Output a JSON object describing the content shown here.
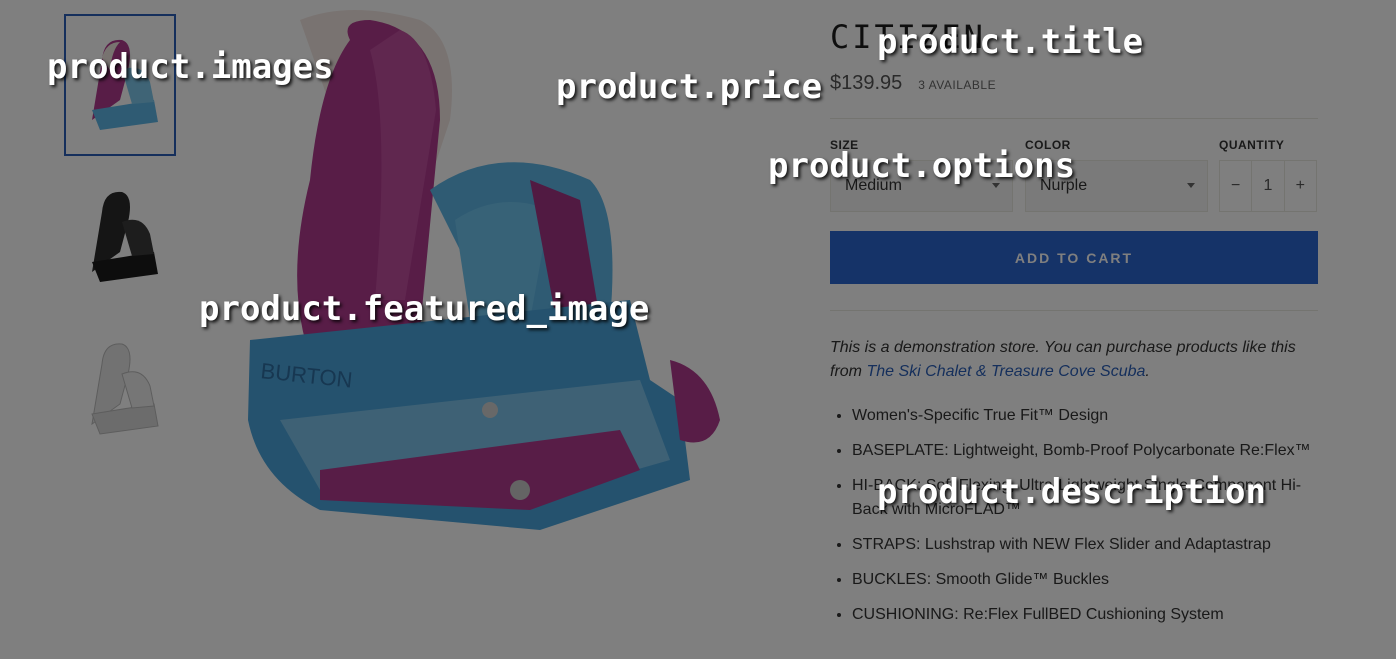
{
  "product": {
    "title": "CITIZEN",
    "price": "$139.95",
    "stock": "3 AVAILABLE",
    "options": {
      "size": {
        "label": "SIZE",
        "value": "Medium"
      },
      "color": {
        "label": "COLOR",
        "value": "Nurple"
      },
      "quantity": {
        "label": "QUANTITY",
        "minus": "−",
        "value": "1",
        "plus": "+"
      }
    },
    "add_to_cart": "ADD TO CART",
    "description": {
      "intro_text": "This is a demonstration store. You can purchase products like this from ",
      "intro_link": "The Ski Chalet & Treasure Cove Scuba",
      "intro_end": ".",
      "bullets": [
        "Women's-Specific True Fit™ Design",
        "BASEPLATE: Lightweight, Bomb-Proof Polycarbonate Re:Flex™",
        "HI-BACK: Soft Flexing, Ultra-Lightweight Single-Component Hi-Back with MicroFLAD™",
        "STRAPS: Lushstrap with NEW Flex Slider and Adaptastrap",
        "BUCKLES: Smooth Glide™ Buckles",
        "CUSHIONING: Re:Flex FullBED Cushioning System"
      ]
    },
    "images": [
      {
        "alt": "purple-blue binding",
        "icon": "binding-purple-icon"
      },
      {
        "alt": "black binding",
        "icon": "binding-black-icon"
      },
      {
        "alt": "white binding",
        "icon": "binding-white-icon"
      }
    ],
    "brand_text_on_binding": "BURTON"
  },
  "overlay_labels": {
    "title": "product.title",
    "images": "product.images",
    "price": "product.price",
    "options": "product.options",
    "featured_image": "product.featured_image",
    "description": "product.description"
  },
  "colors": {
    "accent": "#2a66d1",
    "binding_purple": "#b03a8e",
    "binding_blue": "#5fb6e6"
  }
}
